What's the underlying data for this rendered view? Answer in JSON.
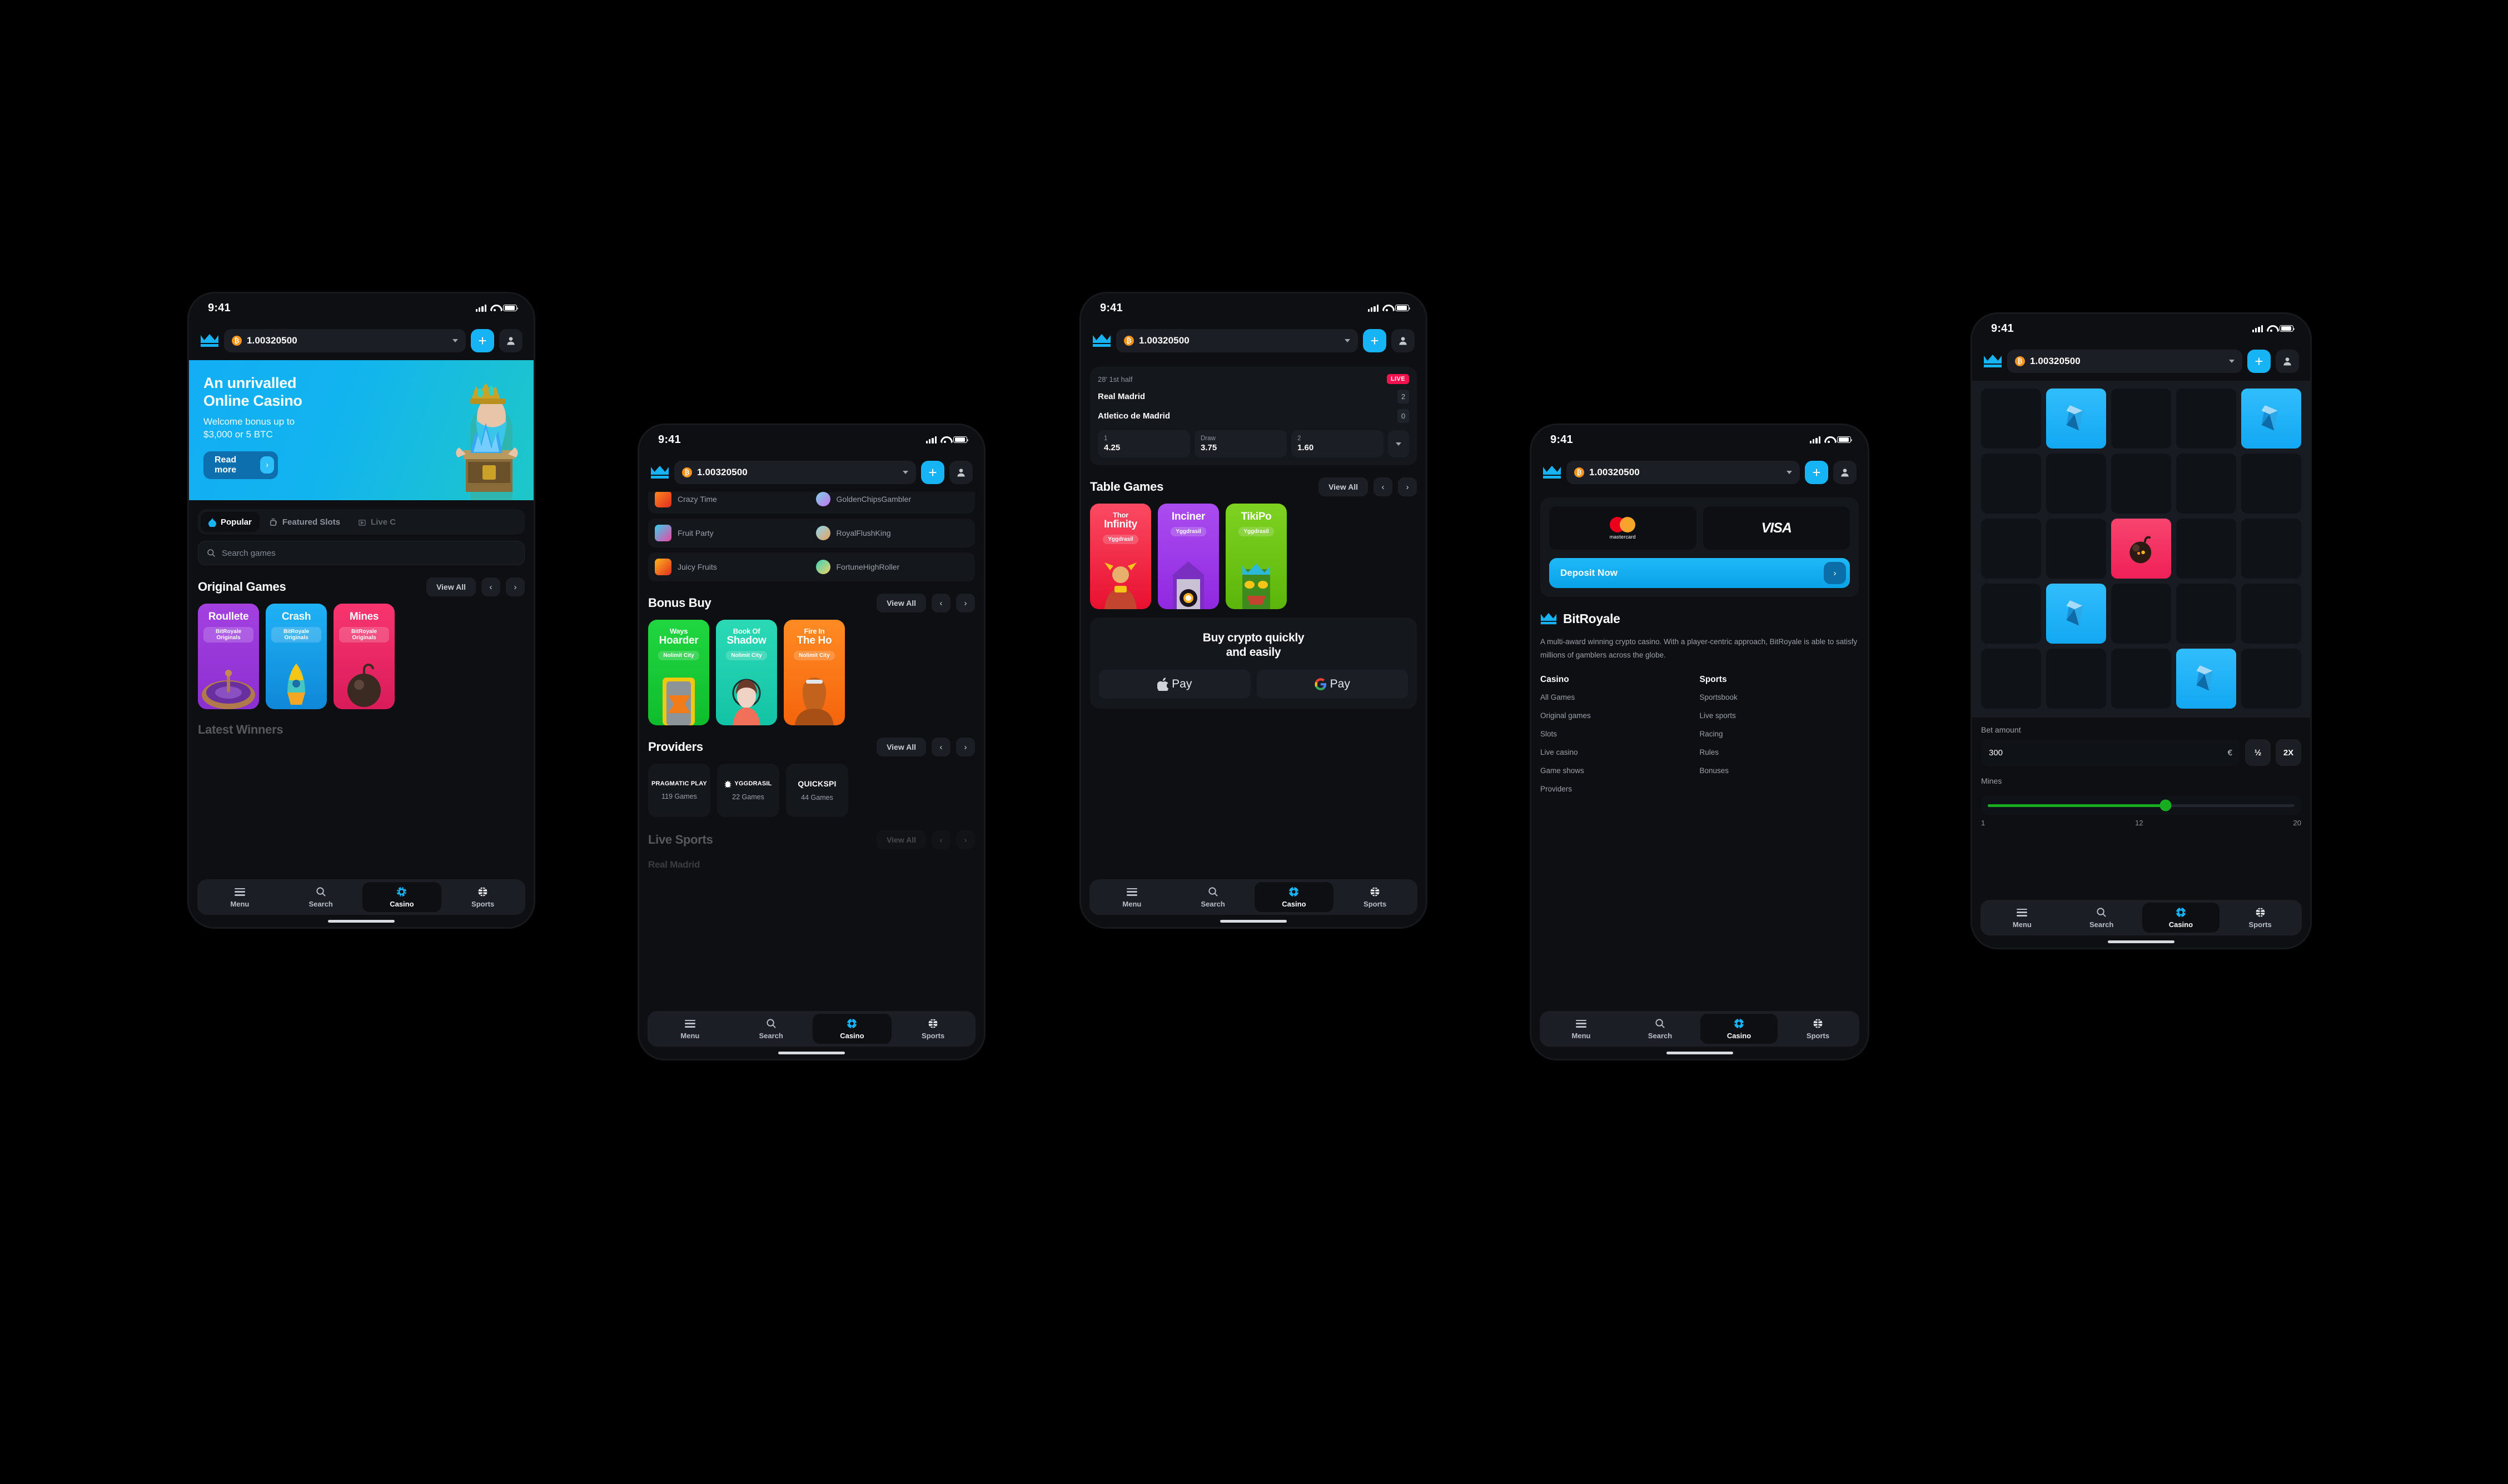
{
  "status_bar": {
    "time": "9:41",
    "signal_icon": "cellular-signal-icon",
    "wifi_icon": "wifi-icon",
    "battery_icon": "battery-icon"
  },
  "header": {
    "logo_icon": "crown-logo-icon",
    "currency_icon": "bitcoin-icon",
    "balance": "1.00320500",
    "dropdown_icon": "chevron-down-icon",
    "add_label": "+",
    "profile_icon": "user-avatar-icon"
  },
  "bottom_nav": {
    "items": [
      {
        "label": "Menu",
        "icon": "hamburger-menu-icon",
        "active": false
      },
      {
        "label": "Search",
        "icon": "search-icon",
        "active": false
      },
      {
        "label": "Casino",
        "icon": "casino-chip-icon",
        "active": true
      },
      {
        "label": "Sports",
        "icon": "basketball-icon",
        "active": false
      }
    ]
  },
  "screen1": {
    "hero": {
      "title_line1": "An unrivalled",
      "title_line2": "Online Casino",
      "subtitle_line1": "Welcome bonus up to",
      "subtitle_line2": "$3,000 or 5 BTC",
      "cta_label": "Read more",
      "cta_icon": "chevron-right-icon",
      "art": "wizard-with-treasure-chest-illustration"
    },
    "tabs": [
      {
        "label": "Popular",
        "icon": "flame-icon",
        "active": true
      },
      {
        "label": "Featured Slots",
        "icon": "slot-machine-icon",
        "active": false
      },
      {
        "label": "Live C",
        "icon": "live-tv-icon",
        "active": false
      }
    ],
    "search_placeholder": "Search games",
    "section": {
      "title": "Original Games",
      "view_all": "View All",
      "prev_icon": "chevron-left-icon",
      "next_icon": "chevron-right-icon"
    },
    "games": [
      {
        "title": "Roullete",
        "provider": "BitRoyale Originals",
        "color1": "#a340e0",
        "color2": "#8c2fd1",
        "art": "roulette-wheel"
      },
      {
        "title": "Crash",
        "provider": "BitRoyale Originals",
        "color1": "#1fb2f5",
        "color2": "#0f87d8",
        "art": "rocket"
      },
      {
        "title": "Mines",
        "provider": "BitRoyale Originals",
        "color1": "#f8356f",
        "color2": "#d91b5a",
        "art": "mine-bomb"
      }
    ],
    "next_section_title": "Latest Winners"
  },
  "screen2": {
    "winners": [
      {
        "game": "Crazy Time",
        "user": "GoldenChipsGambler",
        "game_color1": "#ff8a1e",
        "game_color2": "#e02b1f",
        "avatar_color": "#7fd4e8"
      },
      {
        "game": "Fruit Party",
        "user": "RoyalFlushKing",
        "game_color1": "#35d2ea",
        "game_color2": "#f243a5",
        "avatar_color": "#8fd8f2"
      },
      {
        "game": "Juicy Fruits",
        "user": "FortuneHighRoller",
        "game_color1": "#ffb41e",
        "game_color2": "#e0301f",
        "avatar_color": "#3fd3bb"
      }
    ],
    "bonus_buy": {
      "title": "Bonus Buy",
      "view_all": "View All",
      "games": [
        {
          "title_small": "Ways",
          "title_big": "Hoarder",
          "provider": "Nolimit City",
          "color1": "#20d640",
          "color2": "#0fbd2c"
        },
        {
          "title_small": "Book Of",
          "title_big": "Shadow",
          "provider": "Nolimit City",
          "color1": "#2bd9b5",
          "color2": "#12c3a5"
        },
        {
          "title_small": "Fire In",
          "title_big": "The Ho",
          "provider": "Nolimit City",
          "color1": "#ff8b23",
          "color2": "#f5640c"
        }
      ]
    },
    "providers": {
      "title": "Providers",
      "view_all": "View All",
      "items": [
        {
          "name": "PRAGMATIC PLAY",
          "games": "119 Games"
        },
        {
          "name": "YGGDRASIL",
          "games": "22 Games"
        },
        {
          "name": "QUICKSPI",
          "games": "44 Games"
        }
      ]
    },
    "live_sports": {
      "title": "Live Sports",
      "view_all": "View All"
    },
    "ghost_team": "Real Madrid"
  },
  "screen3": {
    "match": {
      "minute": "28' 1st half",
      "live_badge": "LIVE",
      "home_team": "Real Madrid",
      "home_score": "2",
      "away_team": "Atletico de Madrid",
      "away_score": "0",
      "odds": [
        {
          "key": "1",
          "value": "4.25"
        },
        {
          "key": "Draw",
          "value": "3.75"
        },
        {
          "key": "2",
          "value": "1.60"
        }
      ],
      "more_icon": "chevron-down-icon"
    },
    "table_games": {
      "title": "Table Games",
      "view_all": "View All",
      "games": [
        {
          "title_small": "Thor",
          "title_big": "Infinity",
          "provider": "Yggdrasil",
          "color1": "#fb4a63",
          "color2": "#e8102f"
        },
        {
          "title_small": "",
          "title_big": "Inciner",
          "provider": "Yggdrasil",
          "color1": "#aa4df0",
          "color2": "#9028e0"
        },
        {
          "title_small": "",
          "title_big": "TikiPo",
          "provider": "Yggdrasil",
          "color1": "#7ed321",
          "color2": "#5cb50a"
        }
      ]
    },
    "buy_crypto": {
      "title_line1": "Buy crypto quickly",
      "title_line2": "and easily",
      "buttons": [
        {
          "label": "Pay",
          "icon": "apple-logo-icon"
        },
        {
          "label": "Pay",
          "icon": "google-logo-icon"
        }
      ]
    }
  },
  "screen4": {
    "deposit": {
      "cards": [
        {
          "name": "mastercard",
          "icon": "mastercard-logo-icon"
        },
        {
          "name": "VISA",
          "icon": "visa-logo-icon"
        }
      ],
      "button_label": "Deposit Now",
      "button_icon": "chevron-right-icon"
    },
    "footer": {
      "brand": "BitRoyale",
      "brand_icon": "crown-logo-icon",
      "description": "A multi-award winning crypto casino. With a player-centric approach, BitRoyale is able to satisfy millions of gamblers across the globe.",
      "columns": [
        {
          "heading": "Casino",
          "links": [
            "All Games",
            "Original games",
            "Slots",
            "Live casino",
            "Game shows",
            "Providers"
          ]
        },
        {
          "heading": "Sports",
          "links": [
            "Sportsbook",
            "Live sports",
            "Racing",
            "Rules",
            "Bonuses"
          ]
        }
      ]
    }
  },
  "screen5": {
    "grid": {
      "rows": 5,
      "cols": 5,
      "cells": [
        "empty",
        "gem",
        "empty",
        "empty",
        "gem",
        "empty",
        "empty",
        "empty",
        "empty",
        "empty",
        "empty",
        "empty",
        "bomb",
        "empty",
        "empty",
        "empty",
        "gem",
        "empty",
        "empty",
        "empty",
        "empty",
        "empty",
        "empty",
        "gem",
        "empty"
      ],
      "gem_icon": "blue-gem-icon",
      "bomb_icon": "bomb-icon"
    },
    "bet": {
      "label": "Bet amount",
      "value": "300",
      "currency": "€",
      "half_label": "½",
      "double_label": "2X"
    },
    "mines": {
      "label": "Mines",
      "min": "1",
      "current": "12",
      "max": "20",
      "percent": 58,
      "track_color": "#18ad20"
    }
  },
  "colors": {
    "accent": "#17b4f5",
    "bg": "#0d0f12",
    "surface": "#14171c",
    "surface2": "#1b1f25",
    "text_muted": "#9aa1aa",
    "live": "#f4134e",
    "bitcoin": "#f7931a",
    "slider": "#18ad20"
  }
}
